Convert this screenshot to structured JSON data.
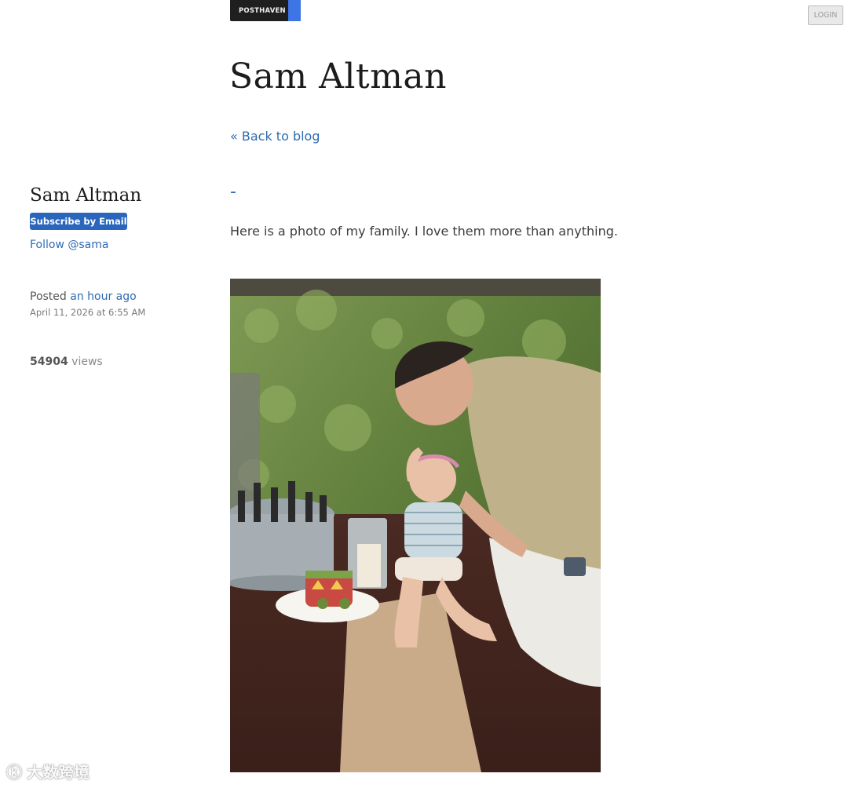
{
  "topbar": {
    "posthaven_label": "POSTHAVEN",
    "login_label": "LOGIN"
  },
  "site": {
    "title": "Sam Altman",
    "back_link": "« Back to blog"
  },
  "sidebar": {
    "author_name": "Sam Altman",
    "subscribe_label": "Subscribe by Email",
    "follow_label": "Follow @sama",
    "posted_prefix": "Posted",
    "posted_relative": "an hour ago",
    "posted_date": "April 11, 2026 at 6:55 AM",
    "views_count": "54904",
    "views_label": "views"
  },
  "post": {
    "title": "-",
    "body": "Here is a photo of my family. I love them more than anything."
  },
  "watermark": {
    "icon": "ⓚ",
    "text": "大数跨境"
  },
  "colors": {
    "link": "#2e6bb2",
    "button": "#2b66bd",
    "badge_dark": "#1f1f1f",
    "badge_blue": "#3d74e6"
  }
}
